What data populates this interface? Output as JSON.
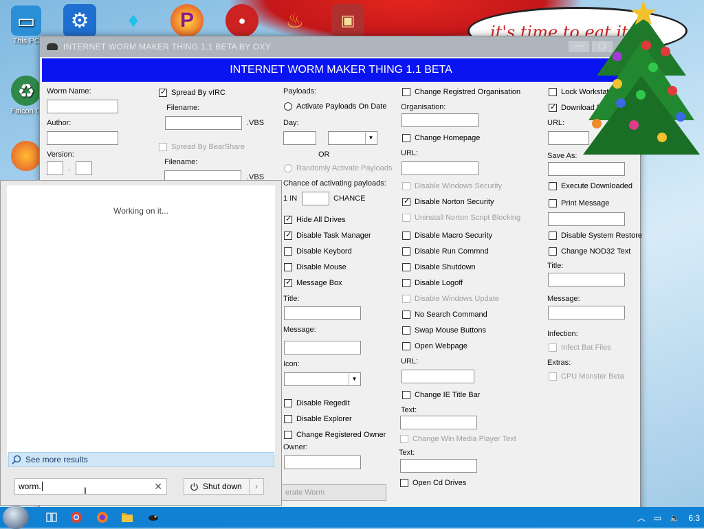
{
  "desktop": {
    "icons": [
      {
        "label": "This PC"
      },
      {
        "label": "Falcon G"
      }
    ],
    "bubble_text": "it's time to eat it"
  },
  "window": {
    "title": "INTERNET WORM MAKER THING 1.1 BETA BY OXY",
    "banner": "INTERNET WORM MAKER THING 1.1 BETA"
  },
  "col1": {
    "worm_name": "Worm Name:",
    "author": "Author:",
    "version": "Version:",
    "version_sep": "."
  },
  "col2": {
    "spread_virc": "Spread By vIRC",
    "filename1": "Filename:",
    "ext1": ".VBS",
    "spread_bearshare": "Spread By BearShare",
    "filename2": "Filename:",
    "ext2": ".VBS"
  },
  "col3": {
    "payloads": "Payloads:",
    "activate_on_date": "Activate Payloads On Date",
    "day": "Day:",
    "or": "OR",
    "randomly": "Randomly Activate Payloads",
    "chance_label": "Chance of activating payloads:",
    "one_in": "1 IN",
    "chance": "CHANCE",
    "hide_drives": "Hide All Drives",
    "disable_taskmgr": "Disable Task Manager",
    "disable_keyboard": "Disable Keybord",
    "disable_mouse": "Disable Mouse",
    "message_box": "Message Box",
    "title": "Title:",
    "message": "Message:",
    "icon": "Icon:",
    "disable_regedit": "Disable Regedit",
    "disable_explorer": "Disable Explorer",
    "change_owner": "Change Registered Owner",
    "owner": "Owner:",
    "generate": "erate Worm"
  },
  "col4": {
    "change_org": "Change Registred Organisation",
    "organisation": "Organisation:",
    "change_home": "Change Homepage",
    "url1": "URL:",
    "disable_winsec": "Disable Windows Security",
    "disable_norton": "Disable Norton Security",
    "uninstall_norton": "Uninstall Norton Script Blocking",
    "disable_macro": "Disable Macro Security",
    "disable_run": "Disable Run Commnd",
    "disable_shutdown": "Disable Shutdown",
    "disable_logoff": "Disable Logoff",
    "disable_winupdate": "Disable Windows Update",
    "no_search": "No Search Command",
    "swap_mouse": "Swap Mouse Buttons",
    "open_webpage": "Open Webpage",
    "url2": "URL:",
    "change_ie_title": "Change IE Title Bar",
    "text1": "Text:",
    "change_wmp": "Change Win Media Player Text",
    "text2": "Text:",
    "open_cd": "Open Cd Drives"
  },
  "col5": {
    "lock_ws": "Lock Workstat",
    "download_file": "Download File",
    "url": "URL:",
    "save_as": "Save As:",
    "execute_downloaded": "Execute Downloaded",
    "print_message": "Print Message",
    "disable_restore": "Disable System Restore",
    "change_nod32": "Change NOD32 Text",
    "title": "Title:",
    "message": "Message:",
    "infection": "Infection:",
    "infect_bat": "Infect Bat Files",
    "extras": "Extras:",
    "cpu_monster": "CPU Monster Beta"
  },
  "flyout": {
    "working": "Working on it...",
    "see_more": "See more results",
    "search_value": "worm.",
    "shutdown": "Shut down"
  },
  "taskbar": {
    "clock": "6:3"
  }
}
